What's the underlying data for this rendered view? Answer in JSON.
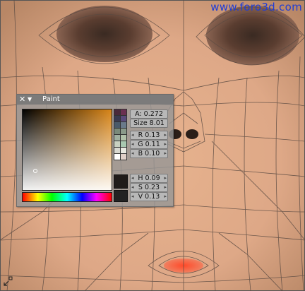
{
  "watermark": "www.foro3d.com",
  "panel": {
    "title": "Paint",
    "close_glyph": "✕",
    "collapse_glyph": "▼"
  },
  "fields": {
    "alpha": "A: 0.272",
    "size": "Size 8.01",
    "r": "R 0.13",
    "g": "G 0.11",
    "b": "B 0.10",
    "h": "H 0.09",
    "s": "S 0.23",
    "v": "V 0.13"
  },
  "colors": {
    "current": "#201c1a",
    "swatches": [
      "#4a2a3a",
      "#6a3050",
      "#3a3a50",
      "#5a4a7a",
      "#4a5a6a",
      "#6a7a8a",
      "#7a8a7a",
      "#8a9a8a",
      "#a0b0a0",
      "#b0c0a8",
      "#c8d0c0",
      "#a8c8b0",
      "#d8d8d0",
      "#e8e8e0",
      "#ffffff",
      "#e0d0c8"
    ]
  },
  "icons": {
    "corner": "tool-icon"
  }
}
